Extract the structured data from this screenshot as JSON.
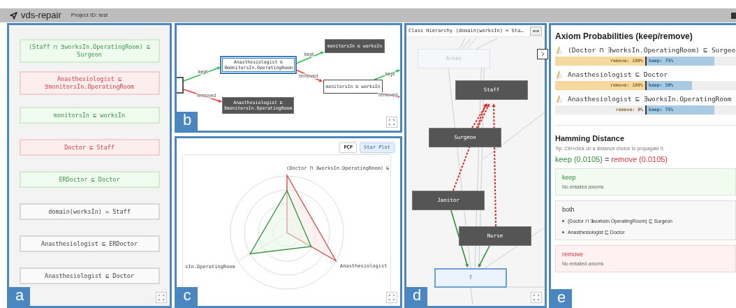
{
  "header": {
    "title": "vds-repair",
    "project": "Project ID: test"
  },
  "panel_labels": [
    "a",
    "b",
    "c",
    "d",
    "e"
  ],
  "axioms": [
    {
      "text": "(Staff ⊓ ∃worksIn.OperatingRoom) ⊑ Surgeon",
      "kind": "keep"
    },
    {
      "text": "Anasthesiologist ⊑ ∃monitorsIn.OperatingRoom",
      "kind": "remove"
    },
    {
      "text": "monitorsIn ⊑ worksIn",
      "kind": "keep"
    },
    {
      "text": "Doctor ⊑ Staff",
      "kind": "remove"
    },
    {
      "text": "ERDoctor ⊑ Doctor",
      "kind": "keep"
    },
    {
      "text": "domain(worksIn) = Staff",
      "kind": "neutral"
    },
    {
      "text": "Anasthesiologist ⊑ ERDoctor",
      "kind": "neutral"
    },
    {
      "text": "Anasthesiologist ⊑ Doctor",
      "kind": "neutral"
    }
  ],
  "repair_tree": {
    "nodes": [
      {
        "text": "Anasthesiologist ⊑ ∃monitorsIn.OperatingRoom",
        "kind": "selected"
      },
      {
        "text": "Anasthesiologist ⊑ ∃monitorsIn.OperatingRoom",
        "kind": "dark"
      },
      {
        "text": "monitorsIn ⊑ worksIn",
        "kind": "dark"
      },
      {
        "text": "monitorsIn ⊑ worksIn",
        "kind": "outline"
      }
    ],
    "edges": [
      {
        "label": "kept",
        "kind": "kept"
      },
      {
        "label": "removed",
        "kind": "removed"
      },
      {
        "label": "kept",
        "kind": "kept"
      },
      {
        "label": "removed",
        "kind": "removed"
      },
      {
        "label": "kept",
        "kind": "kept"
      },
      {
        "label": "removed",
        "kind": "removed"
      }
    ]
  },
  "star_plot": {
    "view_buttons": [
      {
        "label": "PCP",
        "selected": false
      },
      {
        "label": "Star Plot",
        "selected": true
      }
    ],
    "axis_labels": [
      "(Doctor ⊓ ∃worksIn.OperatingRoom) ⊑",
      "sIn.OperatingRoom",
      "Anasthesiologist"
    ]
  },
  "hierarchy": {
    "title": "Class Hierarchy (domain(worksIn) = Sta…",
    "nodes": [
      {
        "text": "Areas",
        "kind": "faded"
      },
      {
        "text": "Staff",
        "kind": "dark"
      },
      {
        "text": "Surgeon",
        "kind": "dark"
      },
      {
        "text": "Janitor",
        "kind": "dark"
      },
      {
        "text": "Nurse",
        "kind": "dark"
      },
      {
        "text": "T",
        "kind": "focus"
      }
    ]
  },
  "probabilities": {
    "heading": "Axiom Probabilities (keep/remove)",
    "items": [
      {
        "axiom": "(Doctor ⊓ ∃worksIn.OperatingRoom) ⊑ Surgeo",
        "remove": {
          "label": "remove: 100%",
          "level": 1
        },
        "keep": {
          "label": "keep: 75%",
          "level": 0.75
        }
      },
      {
        "axiom": "Anasthesiologist ⊑ Doctor",
        "remove": {
          "label": "remove: 100%",
          "level": 1
        },
        "keep": {
          "label": "keep: 50%",
          "level": 0.5
        }
      },
      {
        "axiom": "Anasthesiologist ⊑ ∃worksIn.OperatingRoom",
        "remove": {
          "label": "remove: 0%",
          "level": 0
        },
        "keep": {
          "label": "keep: 75%",
          "level": 0.75
        }
      }
    ]
  },
  "hamming": {
    "heading": "Hamming Distance",
    "tip": "Tip: Ctrl+click on a distance choice to propagate it.",
    "result": {
      "keep": "keep (0.0105)",
      "relation": "=",
      "remove": "remove (0.0105)"
    },
    "groups": [
      {
        "title": "keep",
        "kind": "keep",
        "empty": "No entailed axioms"
      },
      {
        "title": "both",
        "kind": "both",
        "items": [
          "(Doctor ⊓ ∃worksIn.OperatingRoom) ⊑ Surgeon",
          "Anasthesiologist ⊑ Doctor"
        ]
      },
      {
        "title": "remove",
        "kind": "remove",
        "empty": "No entailed axioms"
      }
    ]
  }
}
